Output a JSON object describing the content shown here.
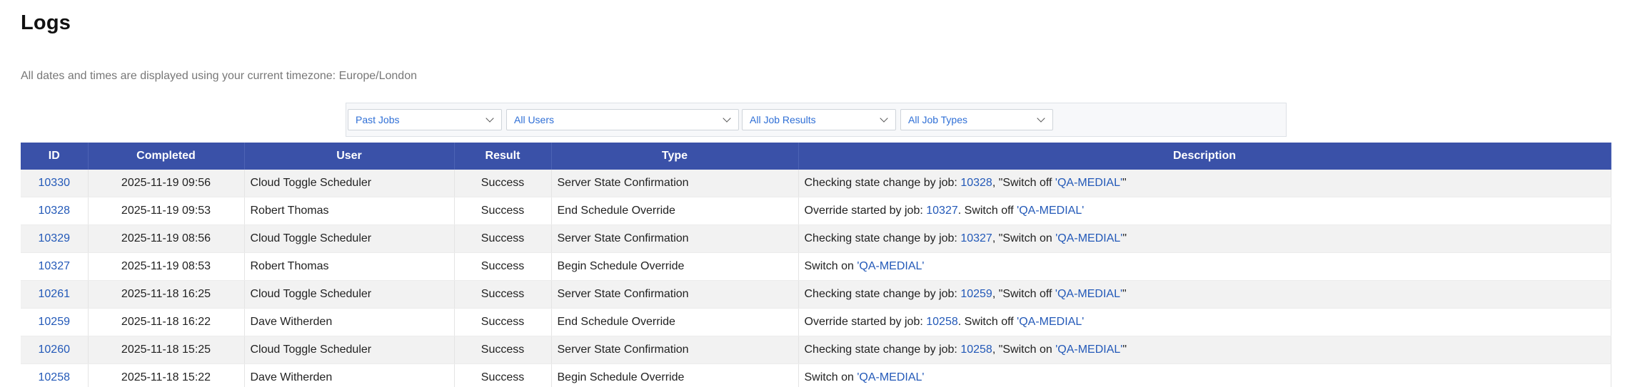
{
  "header": {
    "title": "Logs",
    "timezone_note": "All dates and times are displayed using your current timezone: Europe/London"
  },
  "filters": {
    "job_scope": "Past Jobs",
    "users": "All Users",
    "job_results": "All Job Results",
    "job_types": "All Job Types"
  },
  "table": {
    "columns": [
      "ID",
      "Completed",
      "User",
      "Result",
      "Type",
      "Description"
    ],
    "rows": [
      {
        "id": "10330",
        "completed": "2025-11-19 09:56",
        "user": "Cloud Toggle Scheduler",
        "result": "Success",
        "type": "Server State Confirmation",
        "desc": {
          "prefix": "Checking state change by job: ",
          "job": "10328",
          "middle": ", \"Switch off ",
          "server": "'QA-MEDIAL'",
          "suffix": "\""
        }
      },
      {
        "id": "10328",
        "completed": "2025-11-19 09:53",
        "user": "Robert Thomas",
        "result": "Success",
        "type": "End Schedule Override",
        "desc": {
          "prefix": "Override started by job: ",
          "job": "10327",
          "middle": ". Switch off ",
          "server": "'QA-MEDIAL'",
          "suffix": ""
        }
      },
      {
        "id": "10329",
        "completed": "2025-11-19 08:56",
        "user": "Cloud Toggle Scheduler",
        "result": "Success",
        "type": "Server State Confirmation",
        "desc": {
          "prefix": "Checking state change by job: ",
          "job": "10327",
          "middle": ", \"Switch on ",
          "server": "'QA-MEDIAL'",
          "suffix": "\""
        }
      },
      {
        "id": "10327",
        "completed": "2025-11-19 08:53",
        "user": "Robert Thomas",
        "result": "Success",
        "type": "Begin Schedule Override",
        "desc": {
          "prefix": "Switch on ",
          "job": "",
          "middle": "",
          "server": "'QA-MEDIAL'",
          "suffix": ""
        }
      },
      {
        "id": "10261",
        "completed": "2025-11-18 16:25",
        "user": "Cloud Toggle Scheduler",
        "result": "Success",
        "type": "Server State Confirmation",
        "desc": {
          "prefix": "Checking state change by job: ",
          "job": "10259",
          "middle": ", \"Switch off ",
          "server": "'QA-MEDIAL'",
          "suffix": "\""
        }
      },
      {
        "id": "10259",
        "completed": "2025-11-18 16:22",
        "user": "Dave Witherden",
        "result": "Success",
        "type": "End Schedule Override",
        "desc": {
          "prefix": "Override started by job: ",
          "job": "10258",
          "middle": ". Switch off ",
          "server": "'QA-MEDIAL'",
          "suffix": ""
        }
      },
      {
        "id": "10260",
        "completed": "2025-11-18 15:25",
        "user": "Cloud Toggle Scheduler",
        "result": "Success",
        "type": "Server State Confirmation",
        "desc": {
          "prefix": "Checking state change by job: ",
          "job": "10258",
          "middle": ", \"Switch on ",
          "server": "'QA-MEDIAL'",
          "suffix": "\""
        }
      },
      {
        "id": "10258",
        "completed": "2025-11-18 15:22",
        "user": "Dave Witherden",
        "result": "Success",
        "type": "Begin Schedule Override",
        "desc": {
          "prefix": "Switch on ",
          "job": "",
          "middle": "",
          "server": "'QA-MEDIAL'",
          "suffix": ""
        }
      }
    ]
  },
  "colors": {
    "header_bg": "#3a51a8",
    "link": "#2359b8",
    "filter_text": "#2f6fd6"
  }
}
